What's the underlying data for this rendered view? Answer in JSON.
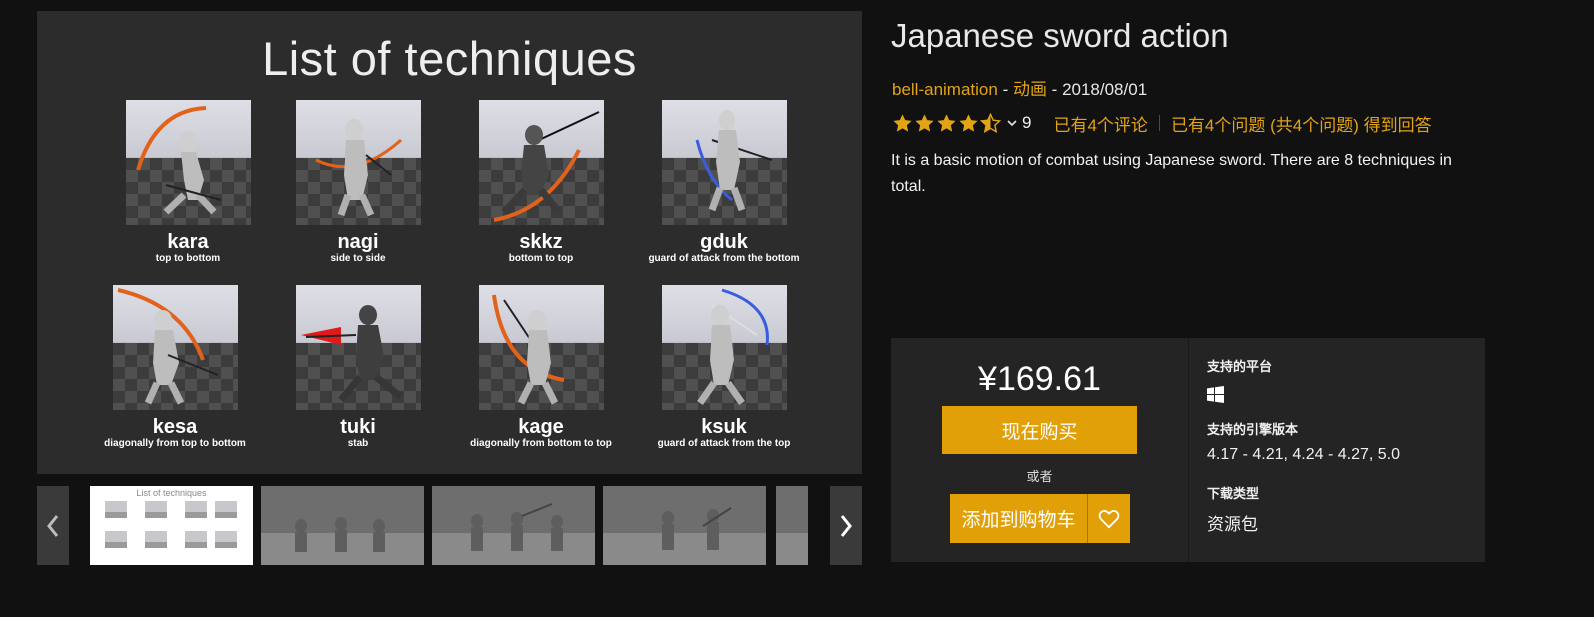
{
  "preview": {
    "title": "List of techniques",
    "techniques": [
      {
        "name": "kara",
        "desc": "top to bottom"
      },
      {
        "name": "nagi",
        "desc": "side to side"
      },
      {
        "name": "skkz",
        "desc": "bottom to top"
      },
      {
        "name": "gduk",
        "desc": "guard of attack from the bottom"
      },
      {
        "name": "kesa",
        "desc": "diagonally from top to bottom"
      },
      {
        "name": "tuki",
        "desc": "stab"
      },
      {
        "name": "kage",
        "desc": "diagonally from bottom to top"
      },
      {
        "name": "ksuk",
        "desc": "guard of attack from the top"
      }
    ]
  },
  "gallery": {
    "first_thumb_title": "List of techniques",
    "prev_icon": "chevron-left-icon",
    "next_icon": "chevron-right-icon"
  },
  "product": {
    "title": "Japanese sword action",
    "seller": "bell-animation",
    "category": "动画",
    "date": "2018/08/01",
    "meta_sep": " - ",
    "rating": 4.5,
    "rating_count": "9",
    "reviews_link": "已有4个评论",
    "questions_link": "已有4个问题 (共4个问题) 得到回答",
    "description": "It is a basic motion of combat using Japanese sword. There are 8 techniques in total."
  },
  "purchase": {
    "price": "¥169.61",
    "buy_now": "现在购买",
    "or": "或者",
    "add_to_cart": "添加到购物车",
    "platforms_label": "支持的平台",
    "platform_icon": "windows-icon",
    "engine_label": "支持的引擎版本",
    "engine_versions": "4.17 - 4.21, 4.24 - 4.27, 5.0",
    "download_type_label": "下载类型",
    "download_type": "资源包"
  },
  "colors": {
    "accent": "#e1a007",
    "link": "#e2a415",
    "background": "#111111",
    "panel": "#242424"
  }
}
